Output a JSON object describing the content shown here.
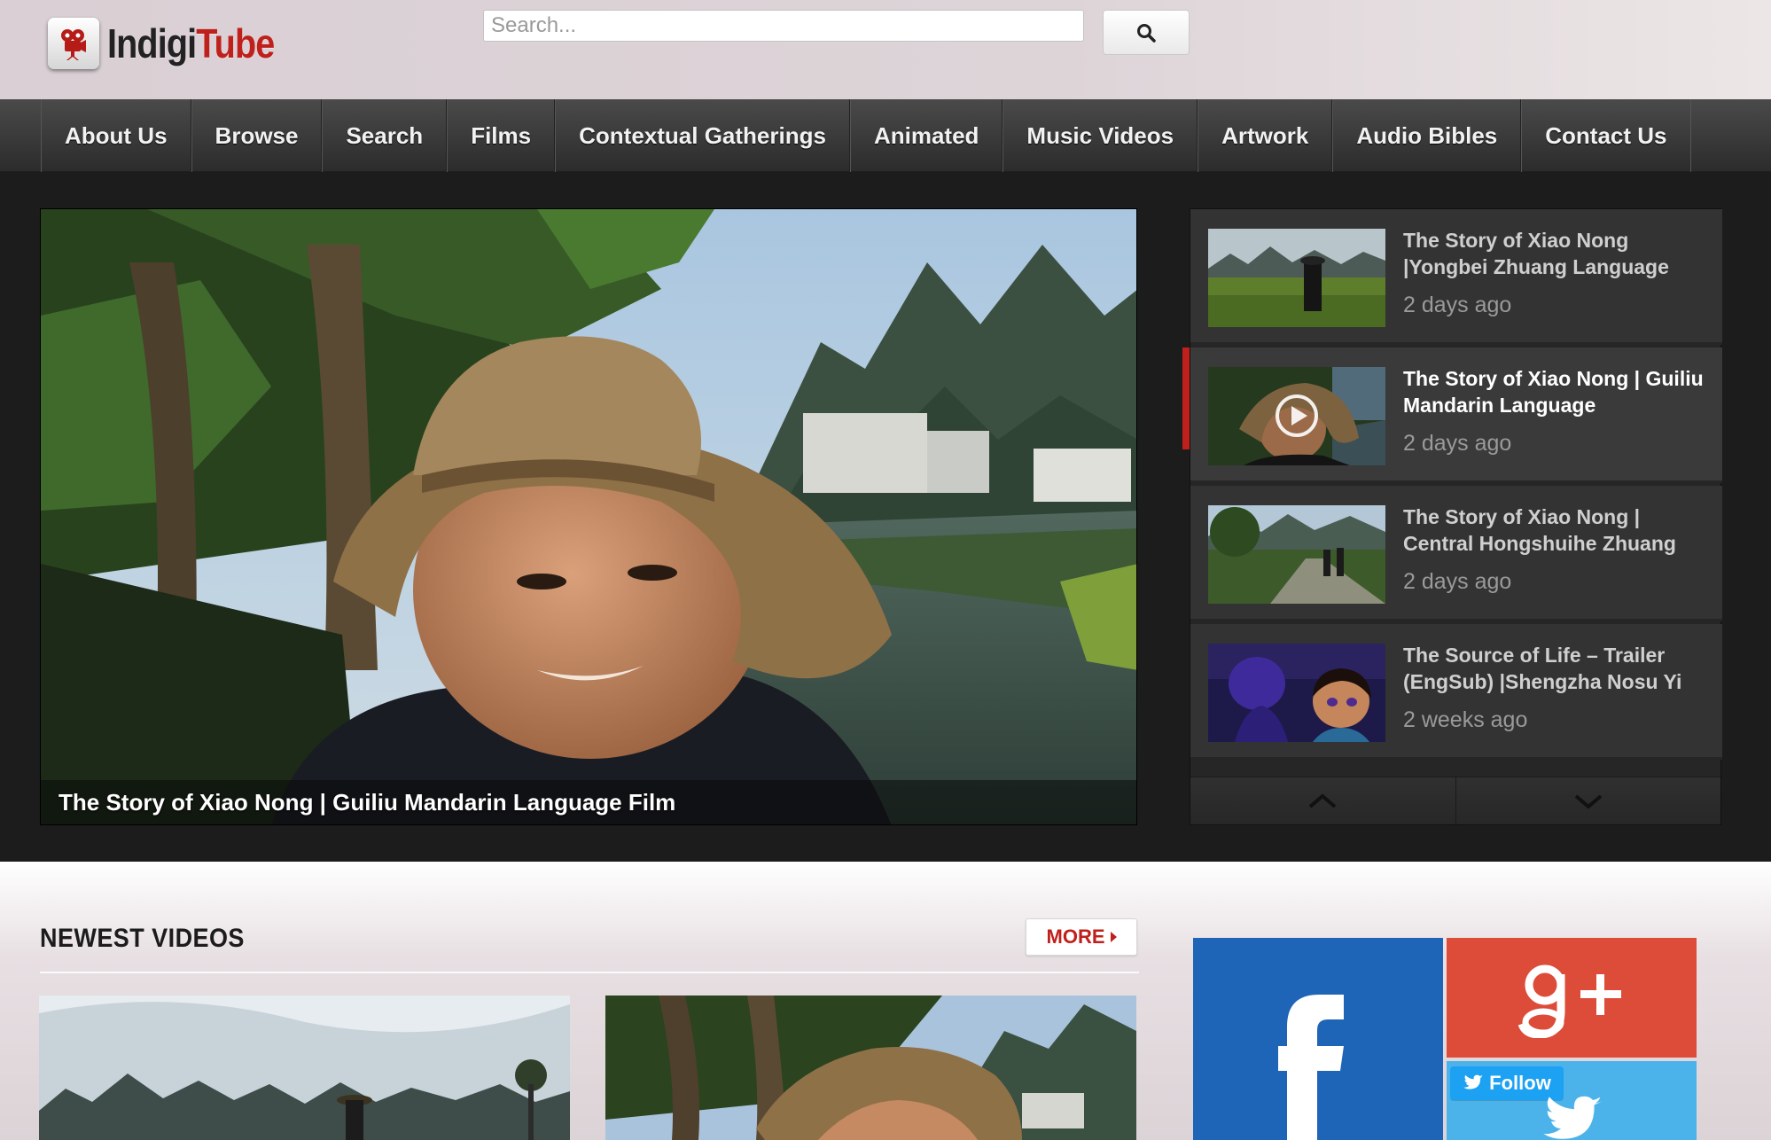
{
  "brand": {
    "name_part1": "Indigi",
    "name_part2": "Tube",
    "accent_color": "#c0201b"
  },
  "search": {
    "placeholder": "Search...",
    "value": "",
    "button_icon": "search-icon"
  },
  "nav": {
    "items": [
      {
        "label": "About Us"
      },
      {
        "label": "Browse"
      },
      {
        "label": "Search"
      },
      {
        "label": "Films"
      },
      {
        "label": "Contextual Gatherings"
      },
      {
        "label": "Animated"
      },
      {
        "label": "Music Videos"
      },
      {
        "label": "Artwork"
      },
      {
        "label": "Audio Bibles"
      },
      {
        "label": "Contact Us"
      }
    ]
  },
  "featured": {
    "caption": "The Story of Xiao Nong | Guiliu Mandarin Language Film"
  },
  "playlist": {
    "items": [
      {
        "title": "The Story of Xiao Nong |Yongbei Zhuang Language",
        "time": "2 days ago",
        "active": false
      },
      {
        "title": "The Story of Xiao Nong | Guiliu Mandarin Language",
        "time": "2 days ago",
        "active": true
      },
      {
        "title": "The Story of Xiao Nong | Central Hongshuihe Zhuang",
        "time": "2 days ago",
        "active": false
      },
      {
        "title": "The Source of Life – Trailer (EngSub) |Shengzha Nosu Yi",
        "time": "2 weeks ago",
        "active": false
      }
    ],
    "up_icon": "chevron-up-icon",
    "down_icon": "chevron-down-icon"
  },
  "newest": {
    "title": "NEWEST VIDEOS",
    "more_label": "MORE"
  },
  "social": {
    "facebook_icon": "facebook-icon",
    "googleplus_icon": "google-plus-icon",
    "twitter_follow_label": "Follow",
    "facebook_color": "#1e64b7",
    "googleplus_color": "#dd4b39",
    "twitter_color": "#4bb3ea"
  }
}
